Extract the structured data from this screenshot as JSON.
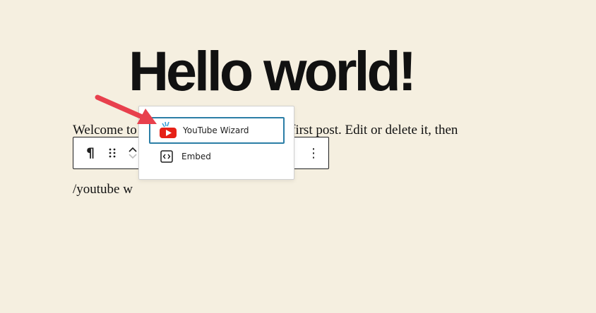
{
  "post": {
    "title": "Hello world!",
    "paragraph_left": "Welcome to",
    "paragraph_right": "first post. Edit or delete it, then",
    "slash_command": "/youtube w"
  },
  "toolbar": {
    "paragraph_symbol": "¶",
    "more_symbol": "⋮"
  },
  "inserter": {
    "items": [
      {
        "label": "YouTube Wizard",
        "icon": "youtube-icon",
        "selected": true
      },
      {
        "label": "Embed",
        "icon": "embed-icon",
        "selected": false
      }
    ]
  },
  "colors": {
    "background": "#f5efe0",
    "selection_border": "#2b7ea6",
    "annotation_arrow": "#e8404d",
    "youtube_red": "#e62117"
  }
}
